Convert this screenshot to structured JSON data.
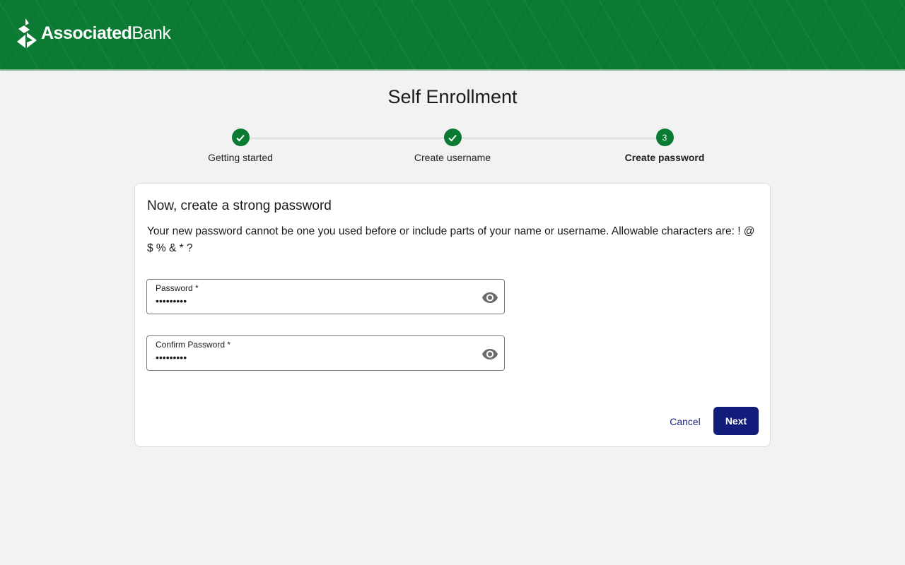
{
  "header": {
    "brand_bold": "Associated",
    "brand_light": "Bank",
    "colors": {
      "primary_green": "#0b7a33",
      "nav_blue": "#121c7a"
    }
  },
  "page": {
    "title": "Self Enrollment"
  },
  "stepper": {
    "steps": [
      {
        "label": "Getting started",
        "status": "complete",
        "icon": "check-icon"
      },
      {
        "label": "Create username",
        "status": "complete",
        "icon": "check-icon"
      },
      {
        "label": "Create password",
        "status": "current",
        "number": "3"
      }
    ]
  },
  "form": {
    "title": "Now, create a strong password",
    "description": "Your new password cannot be one you used before or include parts of your name or username. Allowable characters are: ! @ $ % & * ?",
    "fields": [
      {
        "label": "Password *",
        "value": "•••••••••",
        "icon": "eye-icon"
      },
      {
        "label": "Confirm Password *",
        "value": "•••••••••",
        "icon": "eye-icon"
      }
    ],
    "cancel_label": "Cancel",
    "next_label": "Next"
  }
}
